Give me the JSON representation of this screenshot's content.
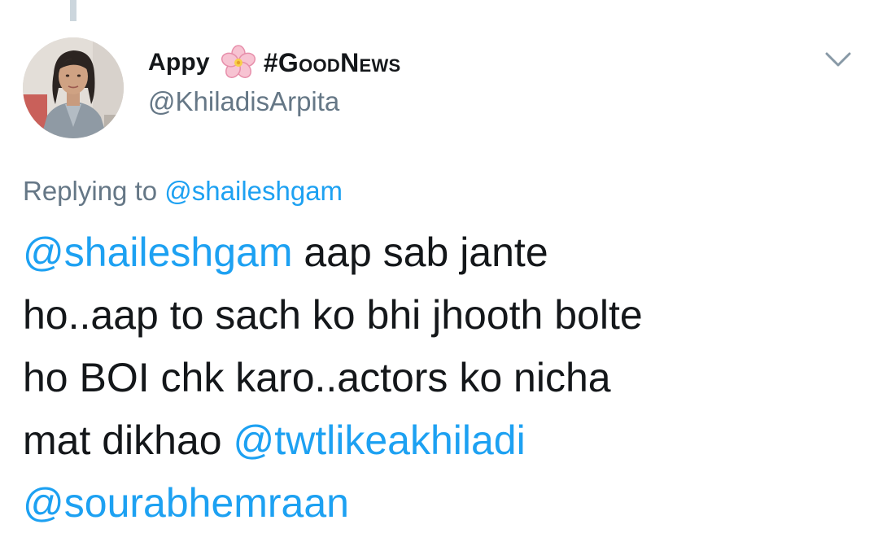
{
  "author": {
    "display_name": "Appy",
    "emoji_icon": "cherry-blossom-icon",
    "hashtag": "#GoodNews",
    "handle": "@KhiladisArpita"
  },
  "menu": {
    "icon": "chevron-down-icon"
  },
  "reply_context": {
    "prefix": "Replying to",
    "mention": "@shaileshgam"
  },
  "tweet": {
    "line1_mention": "@shaileshgam",
    "line1_text": " aap sab jante",
    "line2_text": "ho..aap to sach ko bhi jhooth bolte",
    "line3_text": "ho BOI chk karo..actors ko nicha",
    "line4_text": "mat dikhao ",
    "line4_mention": "@twtlikeakhiladi",
    "line5_mention": "@sourabhemraan"
  },
  "colors": {
    "link": "#1da1f2",
    "secondary_text": "#657786",
    "primary_text": "#14171a",
    "thread_line": "#ccd6dd"
  }
}
